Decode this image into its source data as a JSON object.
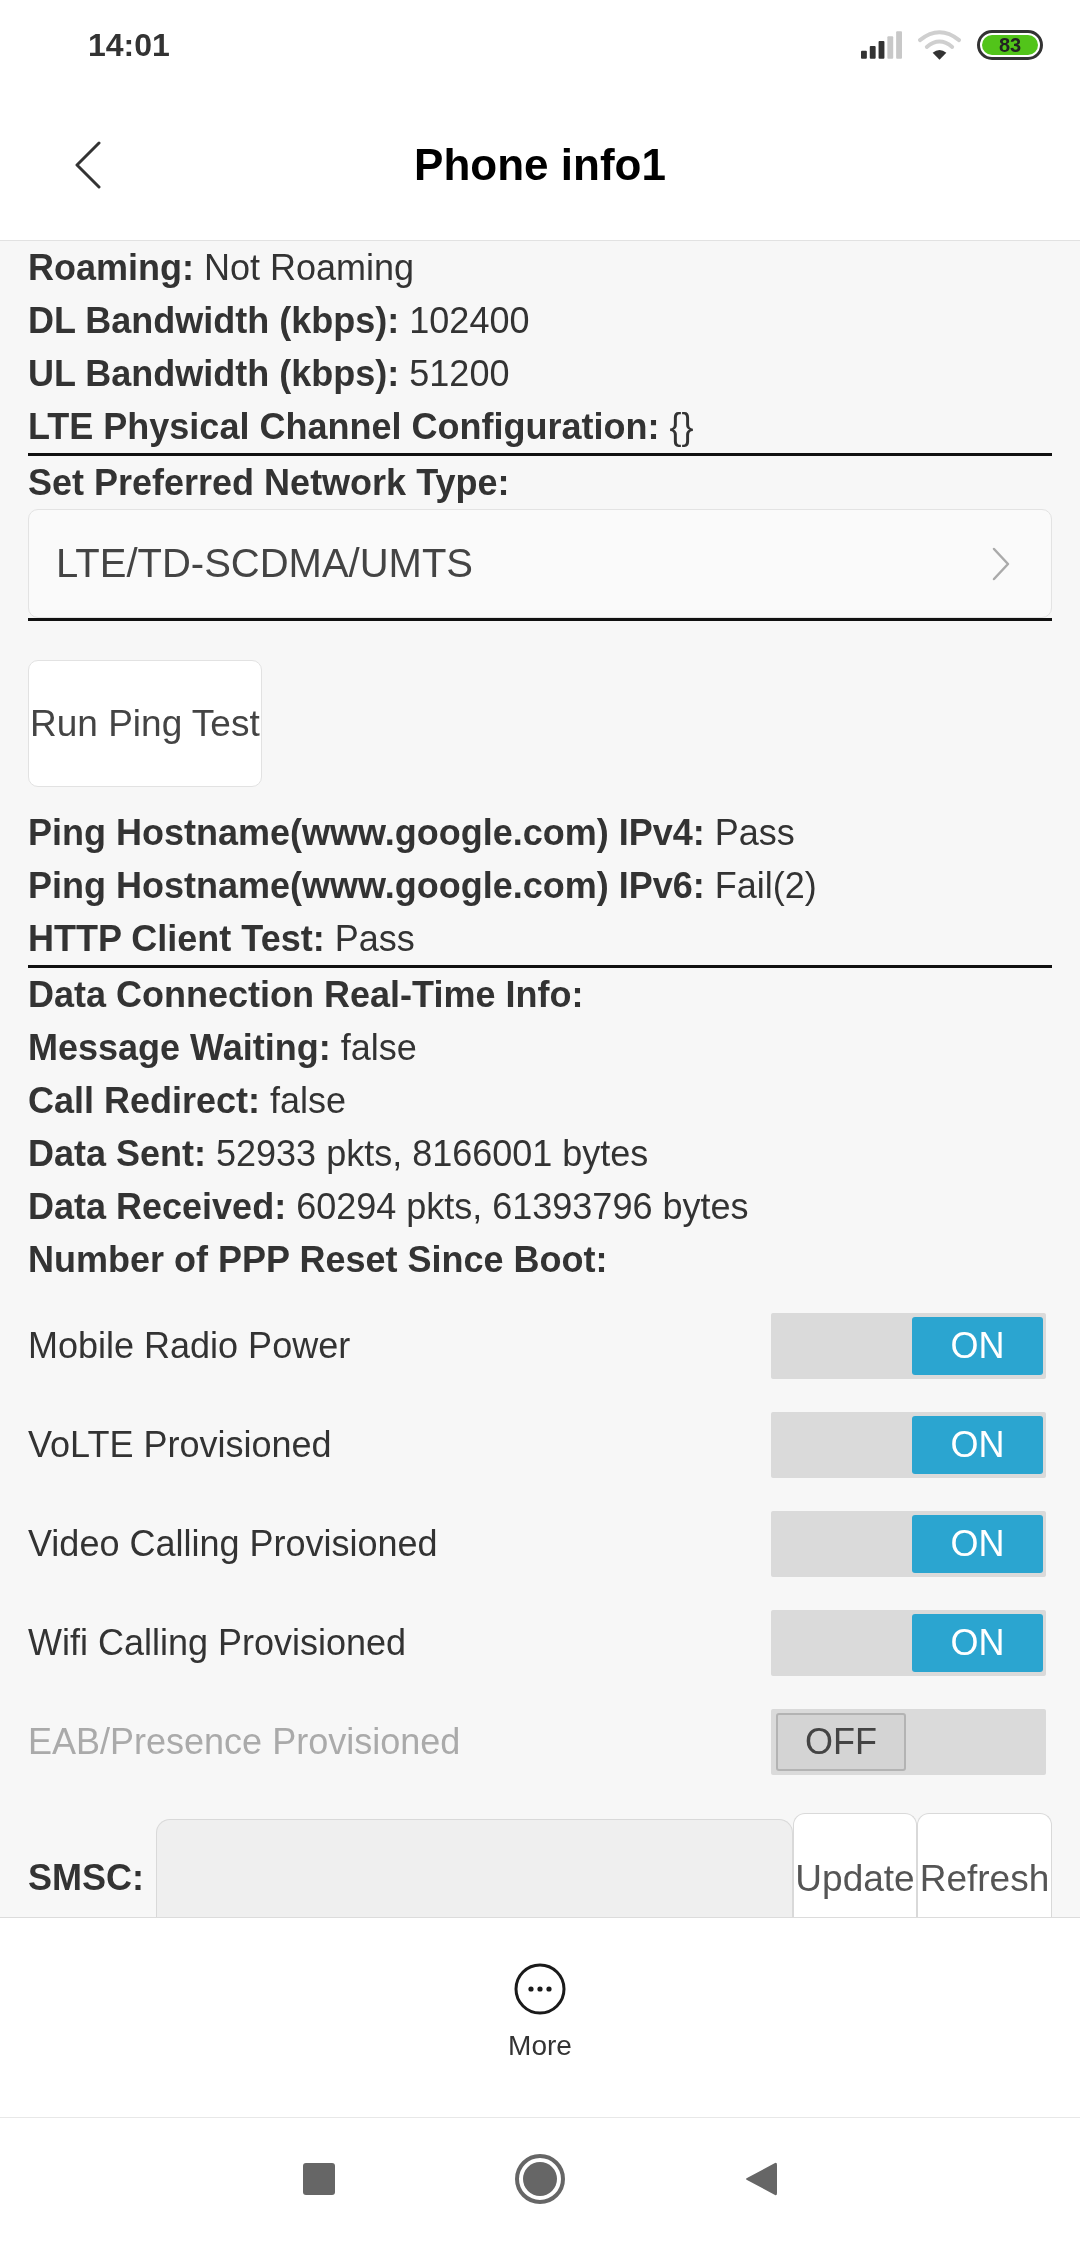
{
  "status_bar": {
    "time": "14:01",
    "battery": "83"
  },
  "header": {
    "title": "Phone info1"
  },
  "radio_info": [
    {
      "label": "Roaming:",
      "value": "Not Roaming"
    },
    {
      "label": "DL Bandwidth (kbps):",
      "value": "102400"
    },
    {
      "label": "UL Bandwidth (kbps):",
      "value": "51200"
    },
    {
      "label": "LTE Physical Channel Configuration:",
      "value": "{}"
    }
  ],
  "preferred_network": {
    "label": "Set Preferred Network Type:",
    "value": "LTE/TD-SCDMA/UMTS"
  },
  "ping_button": "Run Ping Test",
  "ping_results": [
    {
      "label": "Ping Hostname(www.google.com) IPv4:",
      "value": "Pass"
    },
    {
      "label": "Ping Hostname(www.google.com) IPv6:",
      "value": "Fail(2)"
    },
    {
      "label": "HTTP Client Test:",
      "value": "Pass"
    }
  ],
  "data_info": [
    {
      "label": "Data Connection Real-Time Info:"
    },
    {
      "label": "Message Waiting:",
      "value": "false"
    },
    {
      "label": "Call Redirect:",
      "value": "false"
    },
    {
      "label": "Data Sent:",
      "value": "52933 pkts, 8166001 bytes"
    },
    {
      "label": "Data Received:",
      "value": "60294 pkts, 61393796 bytes"
    },
    {
      "label": "Number of PPP Reset Since Boot:"
    }
  ],
  "toggles": [
    {
      "label": "Mobile Radio Power",
      "on": true,
      "disabled": false,
      "state": "ON"
    },
    {
      "label": "VoLTE Provisioned",
      "on": true,
      "disabled": false,
      "state": "ON"
    },
    {
      "label": "Video Calling Provisioned",
      "on": true,
      "disabled": false,
      "state": "ON"
    },
    {
      "label": "Wifi Calling Provisioned",
      "on": true,
      "disabled": false,
      "state": "ON"
    },
    {
      "label": "EAB/Presence Provisioned",
      "on": false,
      "disabled": true,
      "state": "OFF"
    }
  ],
  "smsc": {
    "label": "SMSC:",
    "buttons": [
      "Update",
      "Refresh"
    ]
  },
  "bottom_bar": {
    "more": "More"
  }
}
